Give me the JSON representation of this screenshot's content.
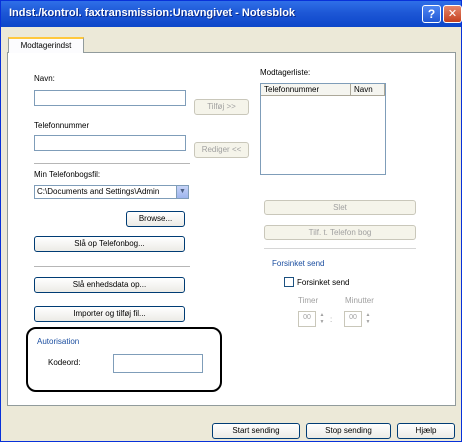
{
  "window": {
    "title": "Indst./kontrol. faxtransmission:Unavngivet - Notesblok",
    "help_glyph": "?",
    "close_glyph": "✕"
  },
  "tabs": [
    {
      "label": "Modtagerindst"
    }
  ],
  "form": {
    "name_label": "Navn:",
    "name_value": "",
    "phone_label": "Telefonnummer",
    "phone_value": "",
    "phonebook_label": "Min Telefonbogsfil:",
    "phonebook_value": "C:\\Documents and Settings\\Admin",
    "browse_label": "Browse...",
    "lookup_phonebook_label": "Slå op Telefonbog...",
    "lookup_device_label": "Slå enhedsdata op...",
    "import_label": "Importer og tilføj fil..."
  },
  "middle": {
    "add_label": "Tilføj >>",
    "edit_label": "Rediger <<"
  },
  "recipients": {
    "label": "Modtagerliste:",
    "columns": [
      "Telefonnummer",
      "Navn"
    ],
    "rows": [],
    "delete_label": "Slet",
    "add_to_phonebook_label": "Tilf. t. Telefon bog"
  },
  "delayed": {
    "group_title": "Forsinket send",
    "checkbox_label": "Forsinket send",
    "checked": false,
    "hours_label": "Timer",
    "minutes_label": "Minutter",
    "hours_value": "00",
    "minutes_value": "00"
  },
  "auth": {
    "group_title": "Autorisation",
    "code_label": "Kodeord:",
    "code_value": ""
  },
  "footer": {
    "start_label": "Start sending",
    "stop_label": "Stop sending",
    "help_label": "Hjælp"
  },
  "colors": {
    "titlebar": "#1d57d6",
    "group_title": "#1b4ea0",
    "disabled_text": "#a0a0a0"
  }
}
